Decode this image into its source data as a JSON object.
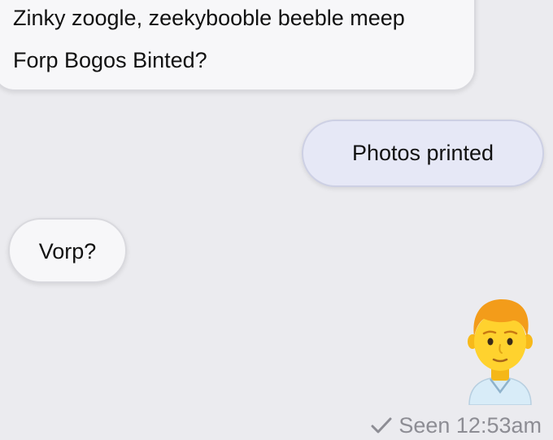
{
  "messages": [
    {
      "direction": "incoming",
      "lines": [
        "Zinky zoogle, zeekybooble beeble meep",
        "Forp Bogos Binted?"
      ]
    },
    {
      "direction": "outgoing",
      "text": "Photos printed"
    },
    {
      "direction": "incoming",
      "text": "Vorp?"
    }
  ],
  "avatar": {
    "icon": "man-emoji-icon",
    "hair_color": "#f39c1a",
    "skin_color": "#ffd22e",
    "shirt_color": "#d8ecf8"
  },
  "receipt": {
    "icon": "checkmark-icon",
    "text": "Seen 12:53am"
  },
  "colors": {
    "background": "#ebebef",
    "incoming_bubble": "#f7f7f9",
    "outgoing_bubble": "#e6e8f6",
    "receipt_text": "#8d8d94"
  }
}
